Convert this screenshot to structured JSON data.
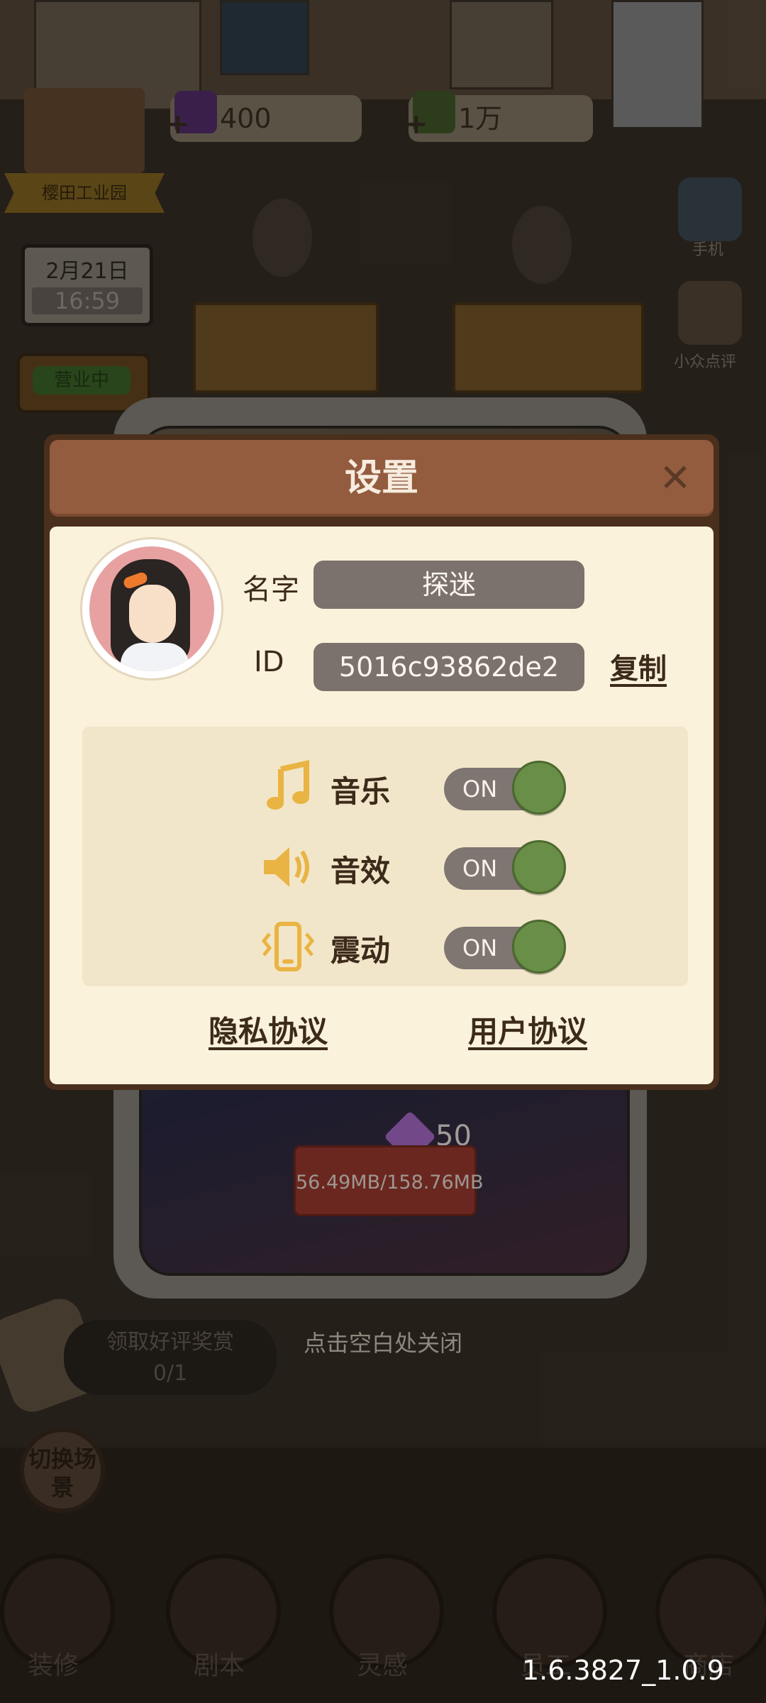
{
  "background": {
    "currency": [
      {
        "value": "400",
        "icon": "gem-icon",
        "color": "#7a3f9a"
      },
      {
        "value": "1万",
        "icon": "cash-icon",
        "color": "#5b8a3a"
      }
    ],
    "location_banner": "樱田工业园",
    "calendar": {
      "date": "2月21日",
      "time": "16:59"
    },
    "open_sign": "营业中",
    "side_menu": [
      {
        "label": "手机",
        "icon": "phone-icon"
      },
      {
        "label": "小众点评",
        "icon": "thumbs-up-icon"
      }
    ],
    "download": {
      "progress": "56.49MB/158.76MB",
      "cost": "50",
      "cost_icon": "diamond-icon"
    },
    "reward": {
      "title": "领取好评奖赏",
      "count": "0/1"
    },
    "switch_scene": "切换场景",
    "bottom_nav": [
      {
        "label": "装修",
        "icon": "toolbox-icon"
      },
      {
        "label": "剧本",
        "icon": "book-icon"
      },
      {
        "label": "灵感",
        "icon": "bulb-icon"
      },
      {
        "label": "员工",
        "icon": "id-card-icon"
      },
      {
        "label": "商店",
        "icon": "shop-icon"
      }
    ]
  },
  "settings_dialog": {
    "title": "设置",
    "close_icon": "close-icon",
    "profile": {
      "name_label": "名字",
      "name_value": "探迷",
      "id_label": "ID",
      "id_value": "5016c93862de2",
      "copy_label": "复制"
    },
    "toggles": [
      {
        "label": "音乐",
        "icon": "music-note-icon",
        "state": "ON"
      },
      {
        "label": "音效",
        "icon": "speaker-icon",
        "state": "ON"
      },
      {
        "label": "震动",
        "icon": "vibrate-icon",
        "state": "ON"
      }
    ],
    "links": {
      "privacy": "隐私协议",
      "user_agreement": "用户协议"
    }
  },
  "close_hint": "点击空白处关闭",
  "version": "1.6.3827_1.0.9",
  "colors": {
    "header": "#935c3e",
    "panel": "#faf2da",
    "toggle_on": "#698e47",
    "accent_gold": "#e9b443"
  }
}
